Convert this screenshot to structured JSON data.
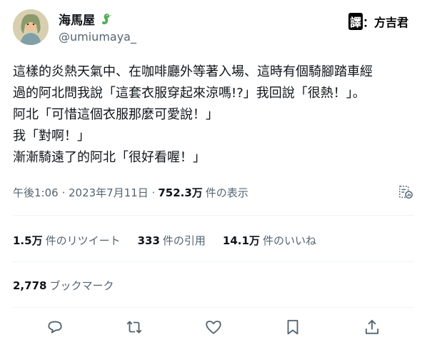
{
  "author": {
    "display_name": "海馬屋",
    "handle": "@umiumaya_"
  },
  "translator_credit": {
    "mark": "譯",
    "separator": "：",
    "name": "方吉君"
  },
  "tweet": {
    "lines": [
      "這樣的炎熱天氣中、在咖啡廳外等著入場、這時有個騎腳踏車經",
      "過的阿北問我說「這套衣服穿起來涼嗎!?」我回說「很熱！」。",
      "阿北「可惜這個衣服那麼可愛說！」",
      "我「對啊！」",
      "漸漸騎遠了的阿北「很好看喔！」"
    ]
  },
  "meta": {
    "timestamp": "午後1:06 · 2023年7月11日 ·",
    "views": "752.3万",
    "views_label": "件の表示"
  },
  "stats": {
    "retweets": {
      "value": "1.5万",
      "label": "件のリツイート"
    },
    "quotes": {
      "value": "333",
      "label": "件の引用"
    },
    "likes": {
      "value": "14.1万",
      "label": "件のいいね"
    }
  },
  "bookmarks": {
    "value": "2,778",
    "label": "ブックマーク"
  },
  "actions": {
    "icons": [
      "reply-icon",
      "retweet-icon",
      "like-icon",
      "bookmark-icon",
      "share-icon"
    ]
  },
  "colors": {
    "text": "#0f1419",
    "secondary": "#536471",
    "divider": "#eff3f4",
    "icon": "#536471"
  }
}
